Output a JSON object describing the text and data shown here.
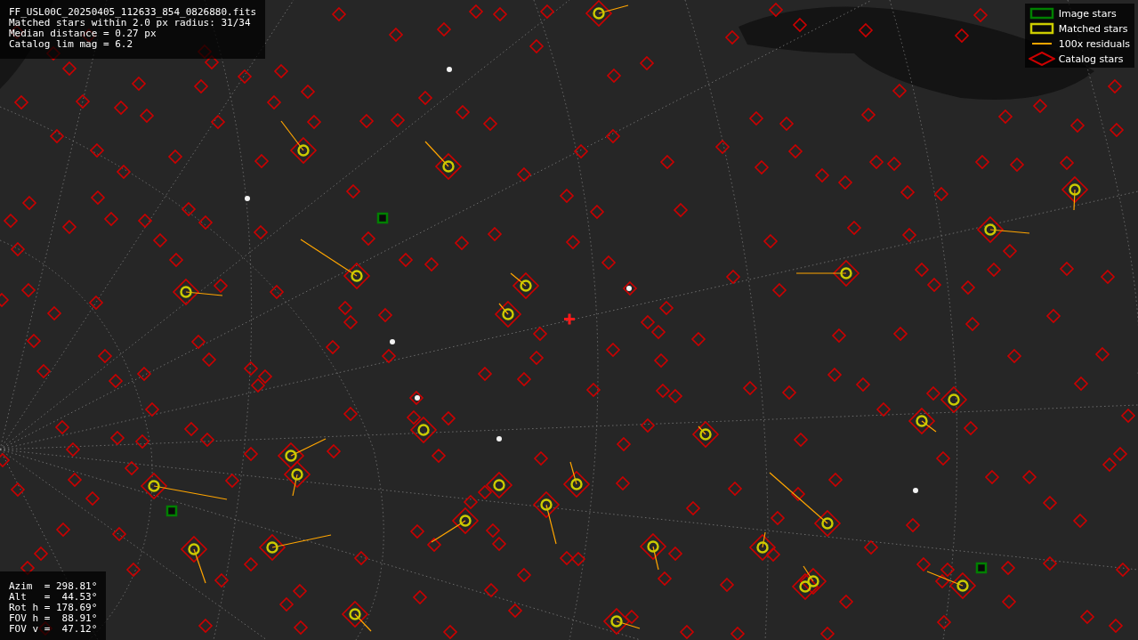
{
  "info_panel": {
    "lines": [
      "FF_USL00C_20250405_112633_854_0826880.fits",
      "Matched stars within 2.0 px radius: 31/34",
      "Median distance = 0.27 px",
      "Catalog lim mag = 6.2"
    ]
  },
  "legend": [
    {
      "kind": "image",
      "label": "Image stars",
      "color": "#008000"
    },
    {
      "kind": "matched",
      "label": "Matched stars",
      "color": "#cccc00"
    },
    {
      "kind": "residual",
      "label": "100x residuals",
      "color": "#ffa500"
    },
    {
      "kind": "catalog",
      "label": "Catalog stars",
      "color": "#cc0000"
    }
  ],
  "pointing_panel": {
    "lines": [
      "Azim  = 298.81°",
      "Alt   =  44.53°",
      "Rot h = 178.69°",
      "FOV h =  88.91°",
      "FOV v =  47.12°"
    ]
  }
}
